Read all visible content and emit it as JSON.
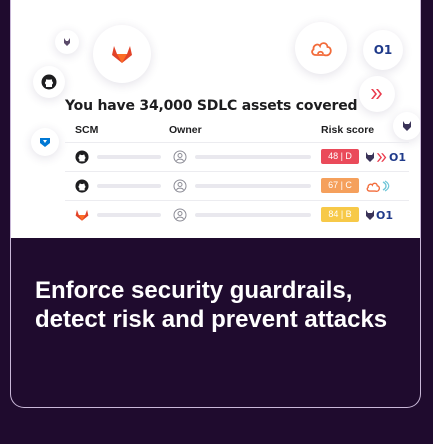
{
  "hero": {
    "summary": "You have 34,000 SDLC assets covered",
    "columns": {
      "scm": "SCM",
      "owner": "Owner",
      "risk": "Risk score"
    },
    "rows": [
      {
        "scm": "github-icon",
        "score": "48 | D",
        "score_color": "#ea4a5a",
        "tools": [
          "wiz-wolf-icon",
          "checkmarx-icon",
          "orca-icon"
        ]
      },
      {
        "scm": "github-icon",
        "score": "67 | C",
        "score_color": "#f5a05c",
        "tools": [
          "cloud-icon",
          "signal-icon"
        ]
      },
      {
        "scm": "gitlab-icon",
        "score": "84 | B",
        "score_color": "#f7c948",
        "tools": [
          "wiz-wolf-icon",
          "orca-icon"
        ]
      }
    ],
    "floating_icons": [
      "wolf-icon",
      "gitlab-icon",
      "cloud-icon",
      "orca-icon",
      "github-icon",
      "checkmarx-icon",
      "azure-devops-icon",
      "wiz-wolf-icon"
    ],
    "orca_logo_text": "O1"
  },
  "footer": {
    "headline": "Enforce security guardrails, detect risk and prevent attacks"
  }
}
